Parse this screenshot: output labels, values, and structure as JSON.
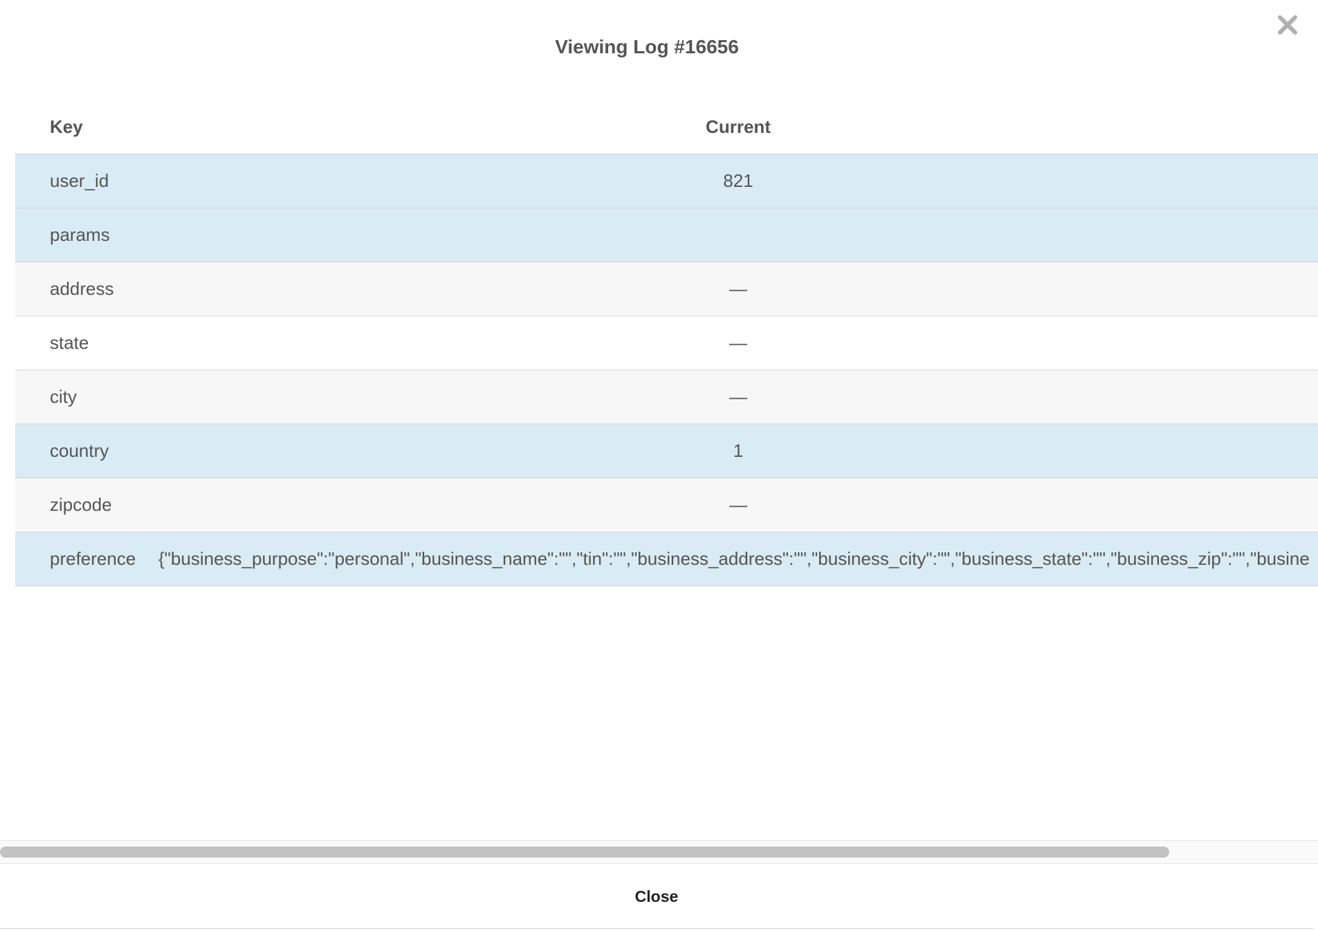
{
  "modal": {
    "title": "Viewing Log #16656",
    "close_icon": "close-x-icon",
    "footer_close_label": "Close"
  },
  "table": {
    "headers": [
      "Key",
      "Current"
    ],
    "rows": [
      {
        "key": "user_id",
        "value": "821",
        "status": "changed"
      },
      {
        "key": "params",
        "value": "",
        "status": "changed"
      },
      {
        "key": "address",
        "value": "—",
        "status": "unchanged"
      },
      {
        "key": "state",
        "value": "—",
        "status": "plain"
      },
      {
        "key": "city",
        "value": "—",
        "status": "unchanged"
      },
      {
        "key": "country",
        "value": "1",
        "status": "changed"
      },
      {
        "key": "zipcode",
        "value": "—",
        "status": "unchanged"
      },
      {
        "key": "preference",
        "value": "{\"business_purpose\":\"personal\",\"business_name\":\"\",\"tin\":\"\",\"business_address\":\"\",\"business_city\":\"\",\"business_state\":\"\",\"business_zip\":\"\",\"busine",
        "status": "changed"
      }
    ]
  },
  "colors": {
    "changed_row": "#d9ebf5",
    "unchanged_row": "#f7f7f7",
    "plain_row": "#ffffff",
    "scrollbar_thumb": "#c2c2c2"
  },
  "scrollbar": {
    "horizontal_position_fraction": 0
  }
}
